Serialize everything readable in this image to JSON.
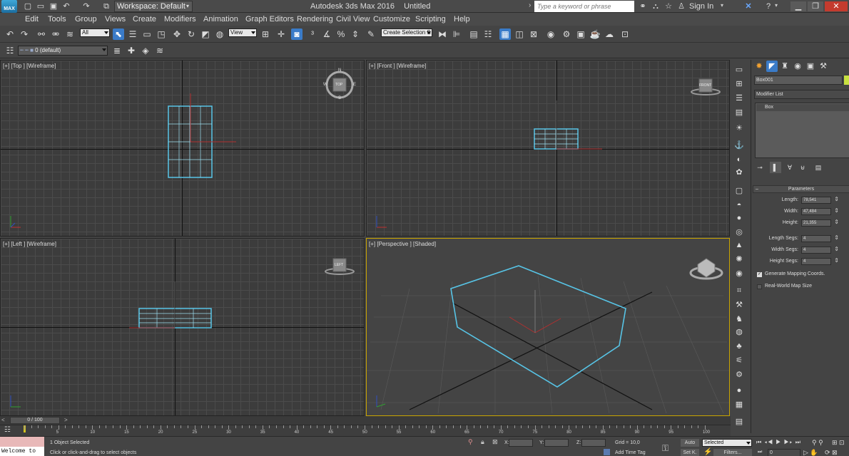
{
  "window": {
    "app_title": "Autodesk 3ds Max 2016",
    "doc_title": "Untitled",
    "workspace": "Workspace: Default",
    "search_placeholder": "Type a keyword or phrase",
    "sign_in": "Sign In",
    "logo": "MAX"
  },
  "menu": [
    "Edit",
    "Tools",
    "Group",
    "Views",
    "Create",
    "Modifiers",
    "Animation",
    "Graph Editors",
    "Rendering",
    "Civil View",
    "Customize",
    "Scripting",
    "Help"
  ],
  "toolbar": {
    "filter": "All",
    "ref_coord": "View",
    "selection_set": "Create Selection S",
    "layer": "0 (default)"
  },
  "viewports": {
    "top": "[+] [Top ] [Wireframe]",
    "front": "[+] [Front ] [Wireframe]",
    "left": "[+] [Left ] [Wireframe]",
    "perspective": "[+] [Perspective ] [Shaded]"
  },
  "viewcube": {
    "top": "TOP",
    "front": "FRONT",
    "left": "LEFT",
    "compass_n": "N",
    "compass_s": "S",
    "compass_w": "W",
    "compass_e": "E"
  },
  "command_panel": {
    "object_name": "Box001",
    "modifier_list": "Modifier List",
    "stack_item": "Box",
    "rollout_title": "Parameters",
    "params": [
      {
        "label": "Length:",
        "value": "78,541"
      },
      {
        "label": "Width:",
        "value": "47,484"
      },
      {
        "label": "Height:",
        "value": "21,355"
      },
      {
        "label": "Length Segs:",
        "value": "4"
      },
      {
        "label": "Width Segs:",
        "value": "4"
      },
      {
        "label": "Height Segs:",
        "value": "4"
      }
    ],
    "gen_mapping": "Generate Mapping Coords.",
    "gen_mapping_checked": true,
    "real_world": "Real-World Map Size",
    "real_world_checked": false,
    "color_swatch": "#c8e040"
  },
  "timeline": {
    "frame": "0 / 100",
    "ruler": [
      0,
      5,
      10,
      15,
      20,
      25,
      30,
      35,
      40,
      45,
      50,
      55,
      60,
      65,
      70,
      75,
      80,
      85,
      90,
      95,
      100
    ]
  },
  "status": {
    "selected": "1 Object Selected",
    "prompt": "Click or click-and-drag to select objects",
    "x_label": "X:",
    "y_label": "Y:",
    "z_label": "Z:",
    "grid": "Grid = 10,0",
    "add_time_tag": "Add Time Tag",
    "auto": "Auto",
    "set_k": "Set K.",
    "selected_dd": "Selected",
    "filters": "Filters...",
    "frame_field": "0",
    "maxscript": "Welcome to"
  }
}
